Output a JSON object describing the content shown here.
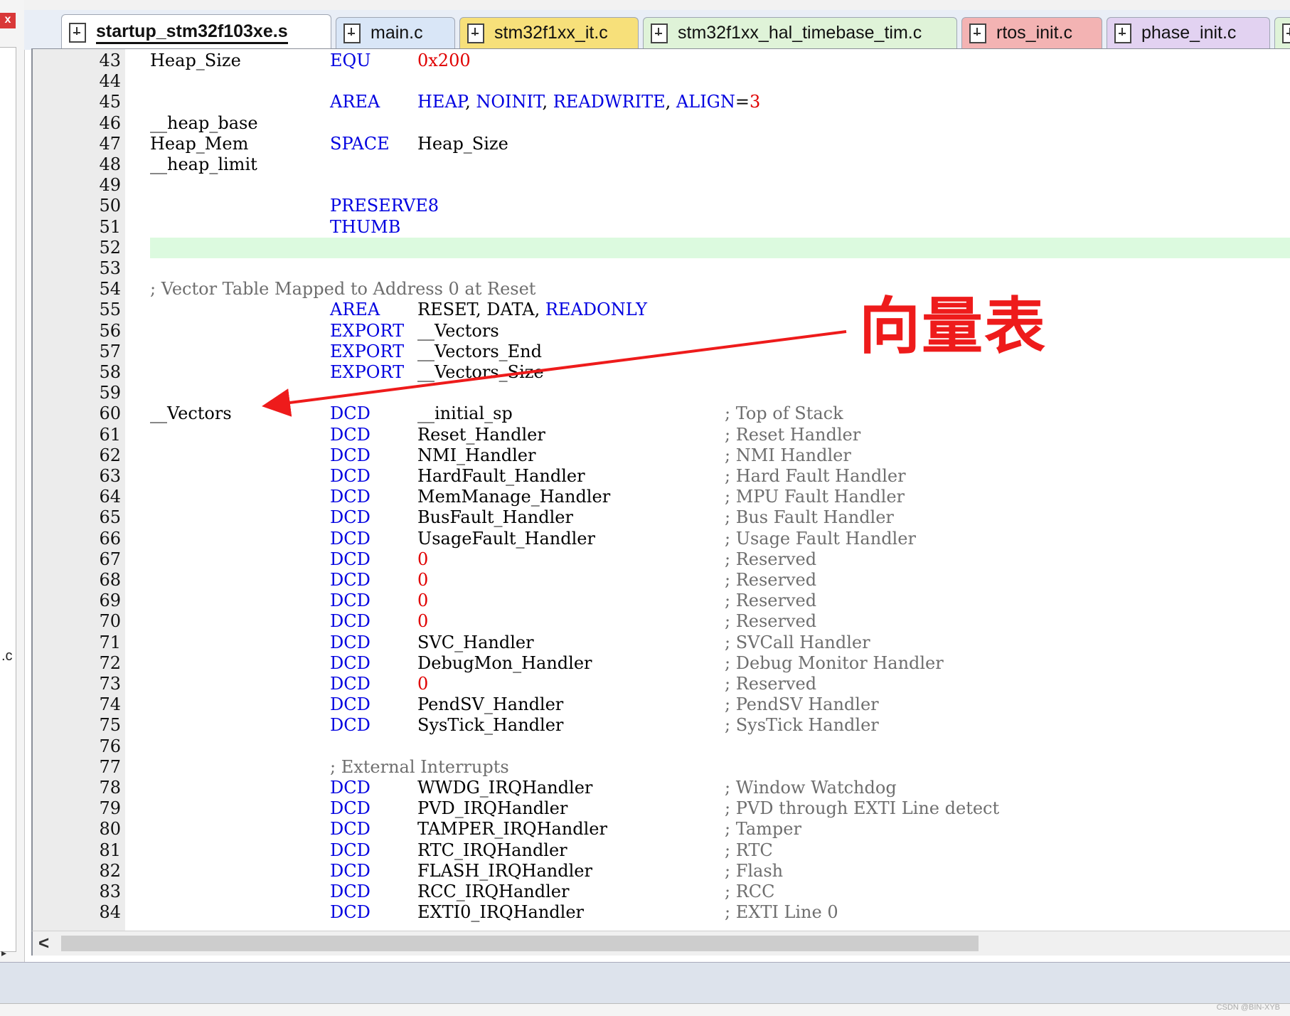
{
  "tabs": [
    {
      "label": "startup_stm32f103xe.s",
      "active": true,
      "color": "#ffffff"
    },
    {
      "label": "main.c",
      "active": false,
      "color": "#d9e6f7"
    },
    {
      "label": "stm32f1xx_it.c",
      "active": false,
      "color": "#f7e07a"
    },
    {
      "label": "stm32f1xx_hal_timebase_tim.c",
      "active": false,
      "color": "#dff3d8"
    },
    {
      "label": "rtos_init.c",
      "active": false,
      "color": "#f3b3b3"
    },
    {
      "label": "phase_init.c",
      "active": false,
      "color": "#e2d2f1"
    },
    {
      "label": "",
      "active": false,
      "color": "#dff3d8"
    }
  ],
  "left_panel": {
    "close": "x",
    "fragment": ".c",
    "arrow": "▸"
  },
  "annotation": {
    "label": "向量表",
    "color": "#ee1b1b"
  },
  "editor": {
    "highlight_line": "52",
    "lines": [
      {
        "n": "43",
        "label": "Heap_Size",
        "kw": "EQU",
        "op": "0x200",
        "op_style": "num",
        "cmt": ""
      },
      {
        "n": "44",
        "label": "",
        "kw": "",
        "op": "",
        "cmt": ""
      },
      {
        "n": "45",
        "label": "",
        "kw": "AREA",
        "op": "",
        "cmt": "",
        "special": "area_heap"
      },
      {
        "n": "46",
        "label": "__heap_base",
        "kw": "",
        "op": "",
        "cmt": ""
      },
      {
        "n": "47",
        "label": "Heap_Mem",
        "kw": "SPACE",
        "op": "Heap_Size",
        "cmt": ""
      },
      {
        "n": "48",
        "label": "__heap_limit",
        "kw": "",
        "op": "",
        "cmt": ""
      },
      {
        "n": "49",
        "label": "",
        "kw": "",
        "op": "",
        "cmt": ""
      },
      {
        "n": "50",
        "label": "",
        "kw": "PRESERVE8",
        "op": "",
        "cmt": ""
      },
      {
        "n": "51",
        "label": "",
        "kw": "THUMB",
        "op": "",
        "cmt": ""
      },
      {
        "n": "52",
        "label": "",
        "kw": "",
        "op": "",
        "cmt": ""
      },
      {
        "n": "53",
        "label": "",
        "kw": "",
        "op": "",
        "cmt": ""
      },
      {
        "n": "54",
        "label": "",
        "kw": "",
        "op": "",
        "cmt": "",
        "line_comment": "; Vector Table Mapped to Address 0 at Reset",
        "lc_x": "label"
      },
      {
        "n": "55",
        "label": "",
        "kw": "AREA",
        "op": "",
        "cmt": "",
        "special": "area_reset"
      },
      {
        "n": "56",
        "label": "",
        "kw": "EXPORT",
        "op": "__Vectors",
        "cmt": ""
      },
      {
        "n": "57",
        "label": "",
        "kw": "EXPORT",
        "op": "__Vectors_End",
        "cmt": ""
      },
      {
        "n": "58",
        "label": "",
        "kw": "EXPORT",
        "op": "__Vectors_Size",
        "cmt": ""
      },
      {
        "n": "59",
        "label": "",
        "kw": "",
        "op": "",
        "cmt": ""
      },
      {
        "n": "60",
        "label": "__Vectors",
        "kw": "DCD",
        "op": "__initial_sp",
        "cmt": "; Top of Stack"
      },
      {
        "n": "61",
        "label": "",
        "kw": "DCD",
        "op": "Reset_Handler",
        "cmt": "; Reset Handler"
      },
      {
        "n": "62",
        "label": "",
        "kw": "DCD",
        "op": "NMI_Handler",
        "cmt": "; NMI Handler"
      },
      {
        "n": "63",
        "label": "",
        "kw": "DCD",
        "op": "HardFault_Handler",
        "cmt": "; Hard Fault Handler"
      },
      {
        "n": "64",
        "label": "",
        "kw": "DCD",
        "op": "MemManage_Handler",
        "cmt": "; MPU Fault Handler"
      },
      {
        "n": "65",
        "label": "",
        "kw": "DCD",
        "op": "BusFault_Handler",
        "cmt": "; Bus Fault Handler"
      },
      {
        "n": "66",
        "label": "",
        "kw": "DCD",
        "op": "UsageFault_Handler",
        "cmt": "; Usage Fault Handler"
      },
      {
        "n": "67",
        "label": "",
        "kw": "DCD",
        "op": "0",
        "op_style": "num",
        "cmt": "; Reserved"
      },
      {
        "n": "68",
        "label": "",
        "kw": "DCD",
        "op": "0",
        "op_style": "num",
        "cmt": "; Reserved"
      },
      {
        "n": "69",
        "label": "",
        "kw": "DCD",
        "op": "0",
        "op_style": "num",
        "cmt": "; Reserved"
      },
      {
        "n": "70",
        "label": "",
        "kw": "DCD",
        "op": "0",
        "op_style": "num",
        "cmt": "; Reserved"
      },
      {
        "n": "71",
        "label": "",
        "kw": "DCD",
        "op": "SVC_Handler",
        "cmt": "; SVCall Handler"
      },
      {
        "n": "72",
        "label": "",
        "kw": "DCD",
        "op": "DebugMon_Handler",
        "cmt": "; Debug Monitor Handler"
      },
      {
        "n": "73",
        "label": "",
        "kw": "DCD",
        "op": "0",
        "op_style": "num",
        "cmt": "; Reserved"
      },
      {
        "n": "74",
        "label": "",
        "kw": "DCD",
        "op": "PendSV_Handler",
        "cmt": "; PendSV Handler"
      },
      {
        "n": "75",
        "label": "",
        "kw": "DCD",
        "op": "SysTick_Handler",
        "cmt": "; SysTick Handler"
      },
      {
        "n": "76",
        "label": "",
        "kw": "",
        "op": "",
        "cmt": ""
      },
      {
        "n": "77",
        "label": "",
        "kw": "",
        "op": "",
        "cmt": "",
        "line_comment": "; External Interrupts",
        "lc_x": "kw"
      },
      {
        "n": "78",
        "label": "",
        "kw": "DCD",
        "op": "WWDG_IRQHandler",
        "cmt": "; Window Watchdog"
      },
      {
        "n": "79",
        "label": "",
        "kw": "DCD",
        "op": "PVD_IRQHandler",
        "cmt": "; PVD through EXTI Line detect"
      },
      {
        "n": "80",
        "label": "",
        "kw": "DCD",
        "op": "TAMPER_IRQHandler",
        "cmt": "; Tamper"
      },
      {
        "n": "81",
        "label": "",
        "kw": "DCD",
        "op": "RTC_IRQHandler",
        "cmt": "; RTC"
      },
      {
        "n": "82",
        "label": "",
        "kw": "DCD",
        "op": "FLASH_IRQHandler",
        "cmt": "; Flash"
      },
      {
        "n": "83",
        "label": "",
        "kw": "DCD",
        "op": "RCC_IRQHandler",
        "cmt": "; RCC"
      },
      {
        "n": "84",
        "label": "",
        "kw": "DCD",
        "op": "EXTI0_IRQHandler",
        "cmt": "; EXTI Line 0"
      }
    ],
    "area_heap": {
      "name": "HEAP",
      "sep1": ", ",
      "attr1": "NOINIT",
      "sep2": ", ",
      "attr2": "READWRITE",
      "sep3": ", ",
      "attr3": "ALIGN",
      "eq": "=",
      "val": "3"
    },
    "area_reset": {
      "name": "RESET",
      "sep1": ", ",
      "attr1": "DATA",
      "sep2": ", ",
      "attr2": "READONLY"
    }
  },
  "scroll": {
    "left_arrow": "<"
  },
  "watermark": "CSDN @BIN-XYB"
}
